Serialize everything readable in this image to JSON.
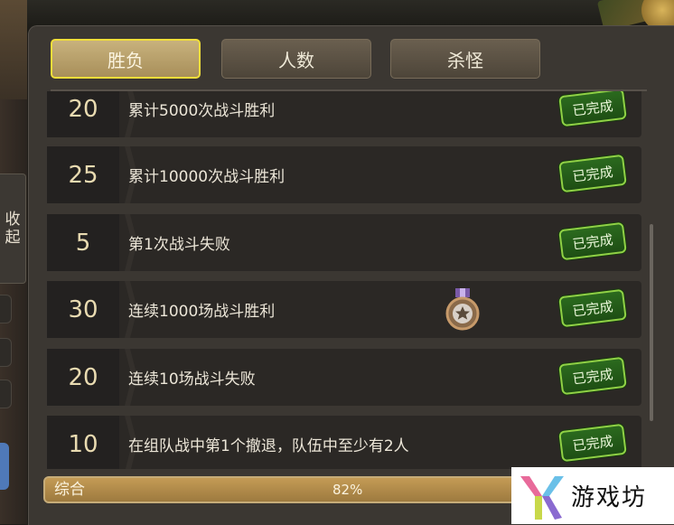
{
  "sidebar": {
    "collapse_label_1": "收",
    "collapse_label_2": "起"
  },
  "tabs": [
    {
      "label": "胜负",
      "active": true
    },
    {
      "label": "人数",
      "active": false
    },
    {
      "label": "杀怪",
      "active": false
    }
  ],
  "achievements": [
    {
      "points": "20",
      "title": "累计5000次战斗胜利",
      "status": "已完成"
    },
    {
      "points": "25",
      "title": "累计10000次战斗胜利",
      "status": "已完成"
    },
    {
      "points": "5",
      "title": "第1次战斗失败",
      "status": "已完成"
    },
    {
      "points": "30",
      "title": "连续1000场战斗胜利",
      "status": "已完成",
      "medal_icon": "star-medal-icon"
    },
    {
      "points": "20",
      "title": "连续10场战斗失败",
      "status": "已完成"
    },
    {
      "points": "10",
      "title": "在组队战中第1个撤退，队伍中至少有2人",
      "status": "已完成"
    }
  ],
  "summary": {
    "label": "综合",
    "percent_text": "82%",
    "progress": 0.82
  },
  "watermark": {
    "text": "游戏坊"
  },
  "colors": {
    "tab_active_border": "#f0de3a",
    "done_badge_border": "#8fd245",
    "done_badge_bg": "#2b6a1e",
    "progress_fill": "#c49b55"
  }
}
